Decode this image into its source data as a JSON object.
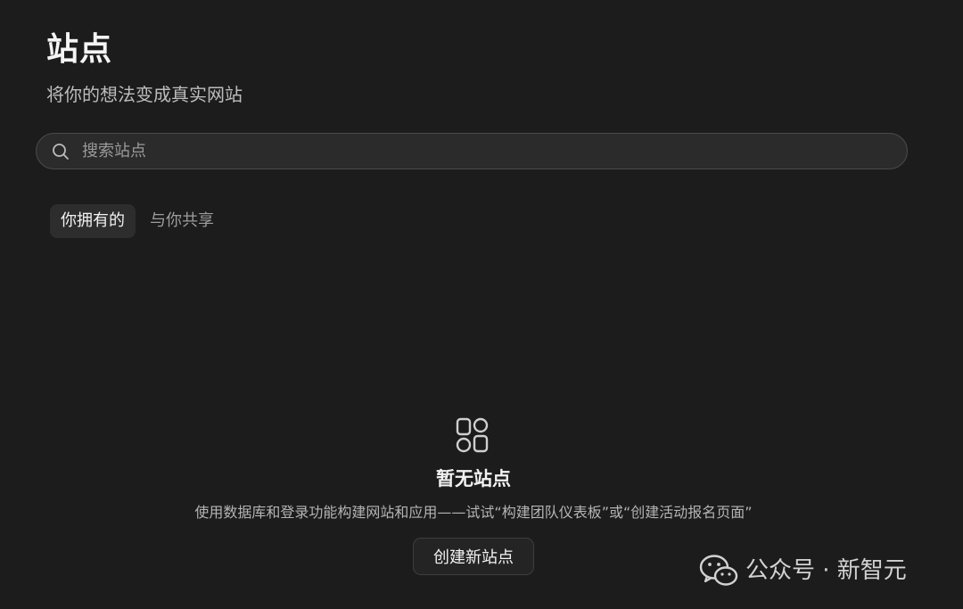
{
  "header": {
    "title": "站点",
    "subtitle": "将你的想法变成真实网站"
  },
  "search": {
    "placeholder": "搜索站点",
    "value": "",
    "icon": "search-icon"
  },
  "tabs": [
    {
      "label": "你拥有的",
      "active": true
    },
    {
      "label": "与你共享",
      "active": false
    }
  ],
  "empty_state": {
    "icon": "apps-icon",
    "title": "暂无站点",
    "description": "使用数据库和登录功能构建网站和应用——试试“构建团队仪表板”或“创建活动报名页面”",
    "button_label": "创建新站点"
  },
  "watermark": {
    "icon": "wechat-icon",
    "text": "公众号 · 新智元"
  },
  "colors": {
    "background": "#1c1c1c",
    "surface": "#2b2b2b",
    "border": "#4a4a4a",
    "text_primary": "#f2f2f2",
    "text_secondary": "#b4b4b4"
  }
}
